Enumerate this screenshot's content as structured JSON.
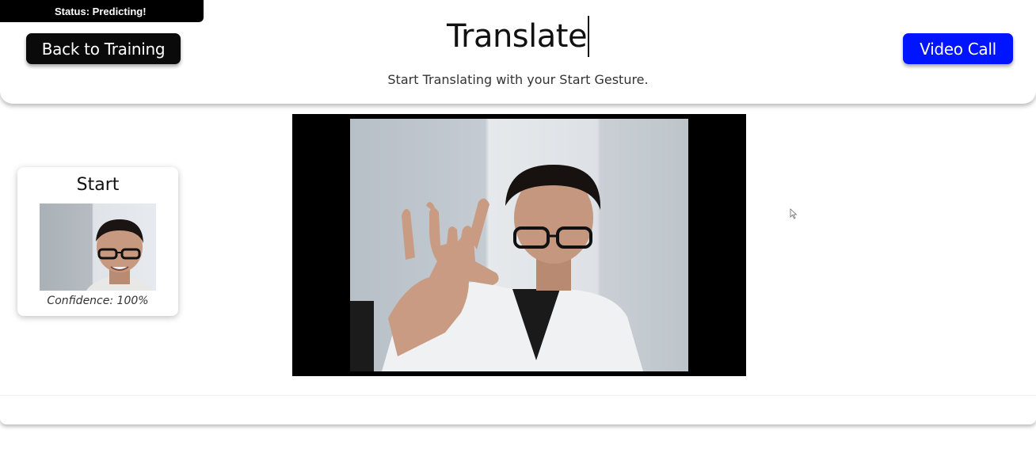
{
  "status": {
    "text": "Status: Predicting!"
  },
  "header": {
    "title": "Translate",
    "subtitle": "Start Translating with your Start Gesture.",
    "back_button_label": "Back to Training",
    "video_call_button_label": "Video Call"
  },
  "gesture_card": {
    "label": "Start",
    "confidence": "Confidence: 100%"
  },
  "colors": {
    "back_button": "#0a0a0a",
    "video_call_button": "#0014ff",
    "status_badge": "#000000"
  },
  "icons": {
    "cursor": "mouse-pointer-icon"
  }
}
